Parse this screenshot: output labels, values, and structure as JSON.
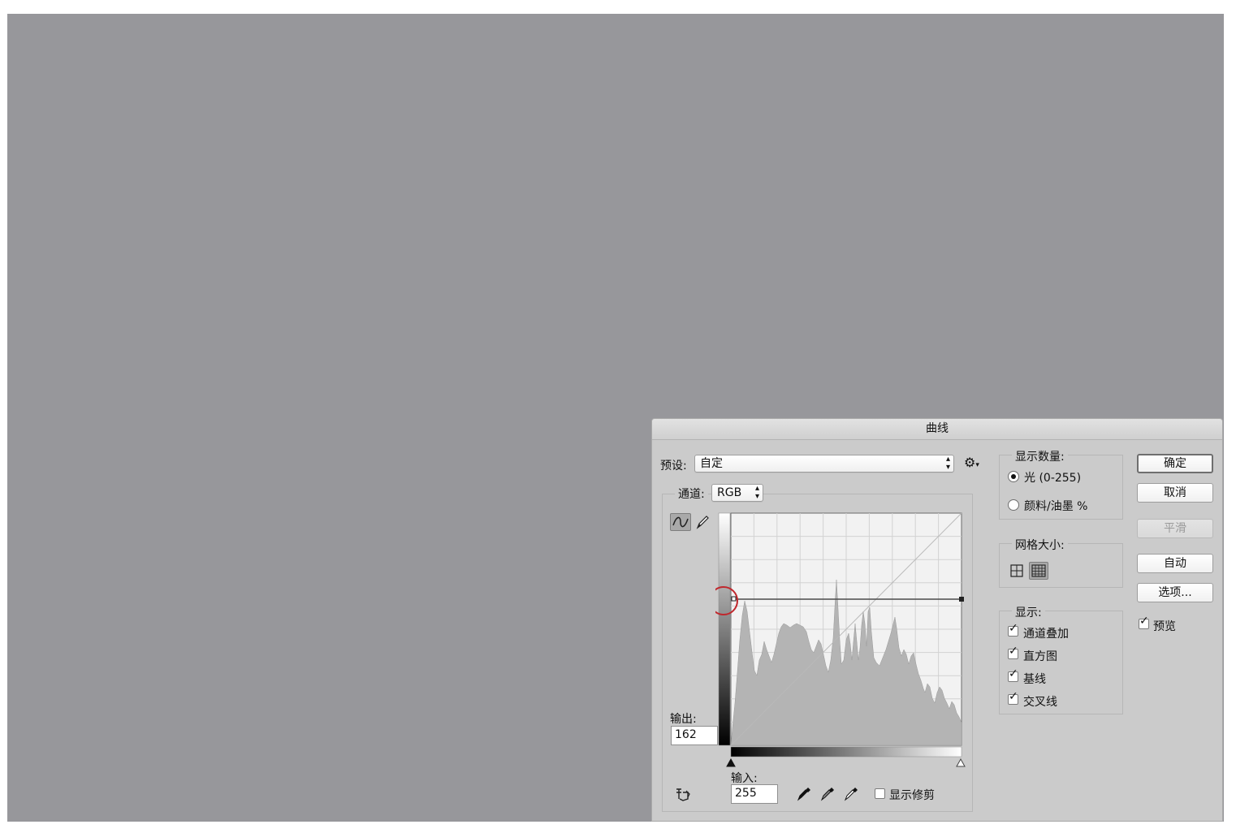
{
  "dialog": {
    "title": "曲线",
    "preset": {
      "label": "预设:",
      "value": "自定"
    },
    "preset_gear_icon": "gear-icon",
    "channel": {
      "label": "通道:",
      "value": "RGB"
    },
    "output": {
      "label": "输出:",
      "value": "162"
    },
    "input": {
      "label": "输入:",
      "value": "255"
    },
    "show_clipping": {
      "label": "显示修剪",
      "checked": false
    },
    "tools": [
      "curve-tool-icon",
      "pencil-tool-icon",
      "hand-adjust-icon",
      "black-eyedropper-icon",
      "gray-eyedropper-icon",
      "white-eyedropper-icon"
    ]
  },
  "display_amount": {
    "title": "显示数量:",
    "options": [
      {
        "label": "光 (0-255)",
        "selected": true
      },
      {
        "label": "颜料/油墨 %",
        "selected": false
      }
    ]
  },
  "grid_size": {
    "title": "网格大小:",
    "options": [
      "simple-grid-icon",
      "detailed-grid-icon"
    ],
    "selected": "detailed-grid-icon"
  },
  "show": {
    "title": "显示:",
    "items": [
      {
        "label": "通道叠加",
        "checked": true
      },
      {
        "label": "直方图",
        "checked": true
      },
      {
        "label": "基线",
        "checked": true
      },
      {
        "label": "交叉线",
        "checked": true
      }
    ]
  },
  "buttons": {
    "ok": "确定",
    "cancel": "取消",
    "smooth": "平滑",
    "auto": "自动",
    "options": "选项..."
  },
  "preview": {
    "label": "预览",
    "checked": true
  },
  "colors": {
    "canvas": "#97979b",
    "dialog": "#cbcbcb",
    "histogram": "#b4b4b4",
    "highlight_circle": "#c0282d"
  }
}
